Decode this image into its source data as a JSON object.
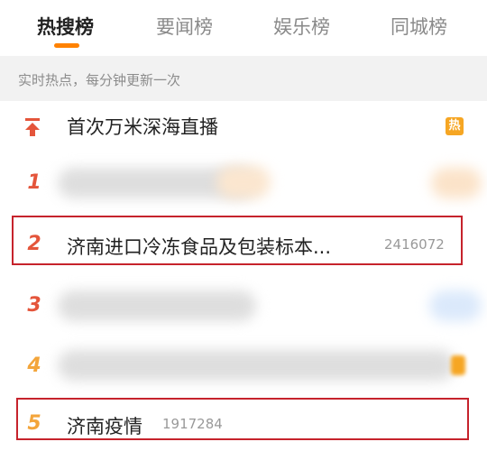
{
  "tabs": [
    {
      "label": "热搜榜"
    },
    {
      "label": "要闻榜"
    },
    {
      "label": "娱乐榜"
    },
    {
      "label": "同城榜"
    }
  ],
  "subtitle": "实时热点，每分钟更新一次",
  "pinned": {
    "title": "首次万米深海直播",
    "badge": "热"
  },
  "rows": [
    {
      "rank": "1",
      "title": "",
      "count": ""
    },
    {
      "rank": "2",
      "title": "济南进口冷冻食品及包装标本...",
      "count": "2416072"
    },
    {
      "rank": "3",
      "title": "",
      "count": ""
    },
    {
      "rank": "4",
      "title": "",
      "count": ""
    },
    {
      "rank": "5",
      "title": "济南疫情",
      "count": "1917284"
    }
  ],
  "colors": {
    "accent": "#ff8200",
    "rank_top": "#e4553b",
    "rank_other": "#f3a53b",
    "highlight_box": "#c6232c"
  }
}
